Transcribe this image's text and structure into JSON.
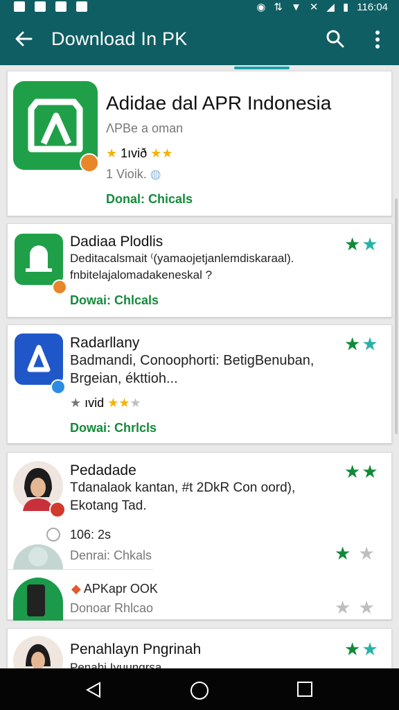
{
  "status_bar": {
    "time": "116:04"
  },
  "app_bar": {
    "title": "Download In PK"
  },
  "featured": {
    "name": "Adidae dal APR Indonesia",
    "subtitle": "ΛPBe a oman",
    "rating_text": "1ıvið",
    "downloads": "1 Vioik.",
    "link": "Donal: Chicals",
    "accent": "#1fa048"
  },
  "items": [
    {
      "name": "Dadiaa Plodlis",
      "desc1": "Deditacalsmait ⁽(yamaojetjanlemdiskaraal).",
      "desc2": "fnbitelajalomadakeneskal ?",
      "link": "Dowai: Chlcals"
    },
    {
      "name": "Radarllany",
      "desc1": "Badmandi, Conoophorti: BetigBenuban,",
      "desc2": "Brgeian, ékttioh...",
      "rating_text": "ıvid",
      "link": "Dowai: Chrlcls"
    },
    {
      "name": "Pedadade",
      "desc1": "Tdanalaok kantan, #t 2DkR Con oord),",
      "desc2": "Ekotang Tad.",
      "sub_value": "106: 2s",
      "sub_link": "Denrai: Chkals",
      "sub2_name": "APKapr OOK",
      "sub2_link": "Donoar Rhlcao"
    },
    {
      "name": "Penahlayn Pngrinah",
      "desc1": "Penahi Iyuungrsa"
    }
  ]
}
